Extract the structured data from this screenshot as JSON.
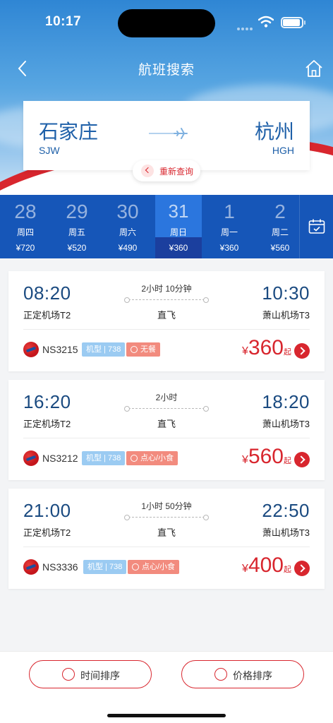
{
  "status_bar": {
    "time": "10:17"
  },
  "nav": {
    "title": "航班搜索",
    "back_icon": "chevron-left-icon",
    "home_icon": "home-icon"
  },
  "route": {
    "from_city": "石家庄",
    "from_code": "SJW",
    "to_city": "杭州",
    "to_code": "HGH",
    "requery_label": "重新查询"
  },
  "dates": [
    {
      "day": "28",
      "weekday": "周四",
      "price": "¥720",
      "active": false
    },
    {
      "day": "29",
      "weekday": "周五",
      "price": "¥520",
      "active": false
    },
    {
      "day": "30",
      "weekday": "周六",
      "price": "¥490",
      "active": false
    },
    {
      "day": "31",
      "weekday": "周日",
      "price": "¥360",
      "active": true
    },
    {
      "day": "1",
      "weekday": "周一",
      "price": "¥360",
      "active": false
    },
    {
      "day": "2",
      "weekday": "周二",
      "price": "¥560",
      "active": false
    }
  ],
  "flights": [
    {
      "dep_time": "08:20",
      "arr_time": "10:30",
      "dep_airport": "正定机场T2",
      "arr_airport": "萧山机场T3",
      "duration": "2小时 10分钟",
      "stop": "直飞",
      "flight_no": "NS3215",
      "aircraft": "机型 | 738",
      "meal": "无餐",
      "currency": "¥",
      "price": "360",
      "price_suffix": "起"
    },
    {
      "dep_time": "16:20",
      "arr_time": "18:20",
      "dep_airport": "正定机场T2",
      "arr_airport": "萧山机场T3",
      "duration": "2小时",
      "stop": "直飞",
      "flight_no": "NS3212",
      "aircraft": "机型 | 738",
      "meal": "点心/小食",
      "currency": "¥",
      "price": "560",
      "price_suffix": "起"
    },
    {
      "dep_time": "21:00",
      "arr_time": "22:50",
      "dep_airport": "正定机场T2",
      "arr_airport": "萧山机场T3",
      "duration": "1小时 50分钟",
      "stop": "直飞",
      "flight_no": "NS3336",
      "aircraft": "机型 | 738",
      "meal": "点心/小食",
      "currency": "¥",
      "price": "400",
      "price_suffix": "起"
    }
  ],
  "sort": {
    "time_label": "时间排序",
    "price_label": "价格排序"
  },
  "colors": {
    "accent_red": "#d8262e",
    "date_strip": "#1656b8",
    "time_text": "#1a4a80"
  }
}
